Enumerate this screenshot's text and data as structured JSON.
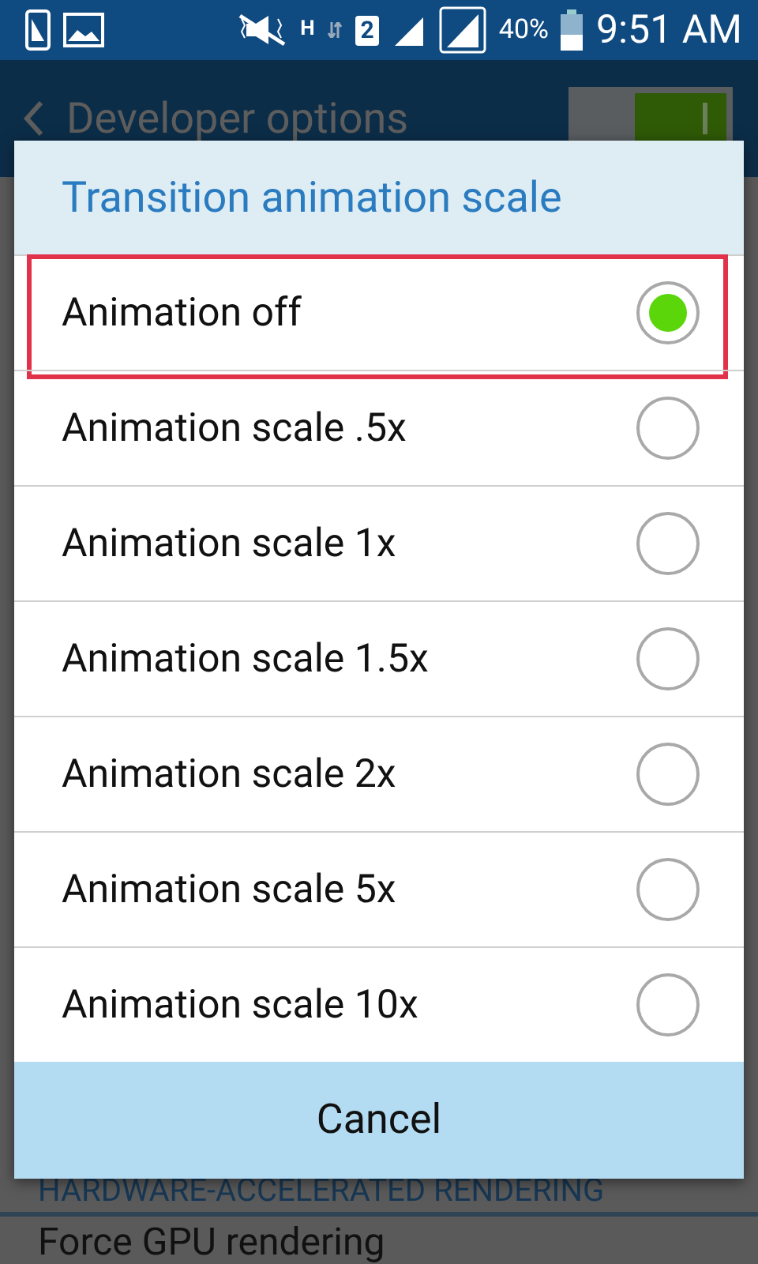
{
  "status_bar": {
    "network_type": "H",
    "sim_slot": "2",
    "battery_percent": "40%",
    "time": "9:51 AM"
  },
  "header": {
    "title": "Developer options",
    "master_switch": {
      "on": true
    }
  },
  "background": {
    "section_heading": "HARDWARE-ACCELERATED RENDERING",
    "next_item": "Force GPU rendering"
  },
  "dialog": {
    "title": "Transition animation scale",
    "options": [
      {
        "label": "Animation off",
        "selected": true,
        "highlighted": true
      },
      {
        "label": "Animation scale .5x",
        "selected": false,
        "highlighted": false
      },
      {
        "label": "Animation scale 1x",
        "selected": false,
        "highlighted": false
      },
      {
        "label": "Animation scale 1.5x",
        "selected": false,
        "highlighted": false
      },
      {
        "label": "Animation scale 2x",
        "selected": false,
        "highlighted": false
      },
      {
        "label": "Animation scale 5x",
        "selected": false,
        "highlighted": false
      },
      {
        "label": "Animation scale 10x",
        "selected": false,
        "highlighted": false
      }
    ],
    "cancel_button": "Cancel"
  }
}
